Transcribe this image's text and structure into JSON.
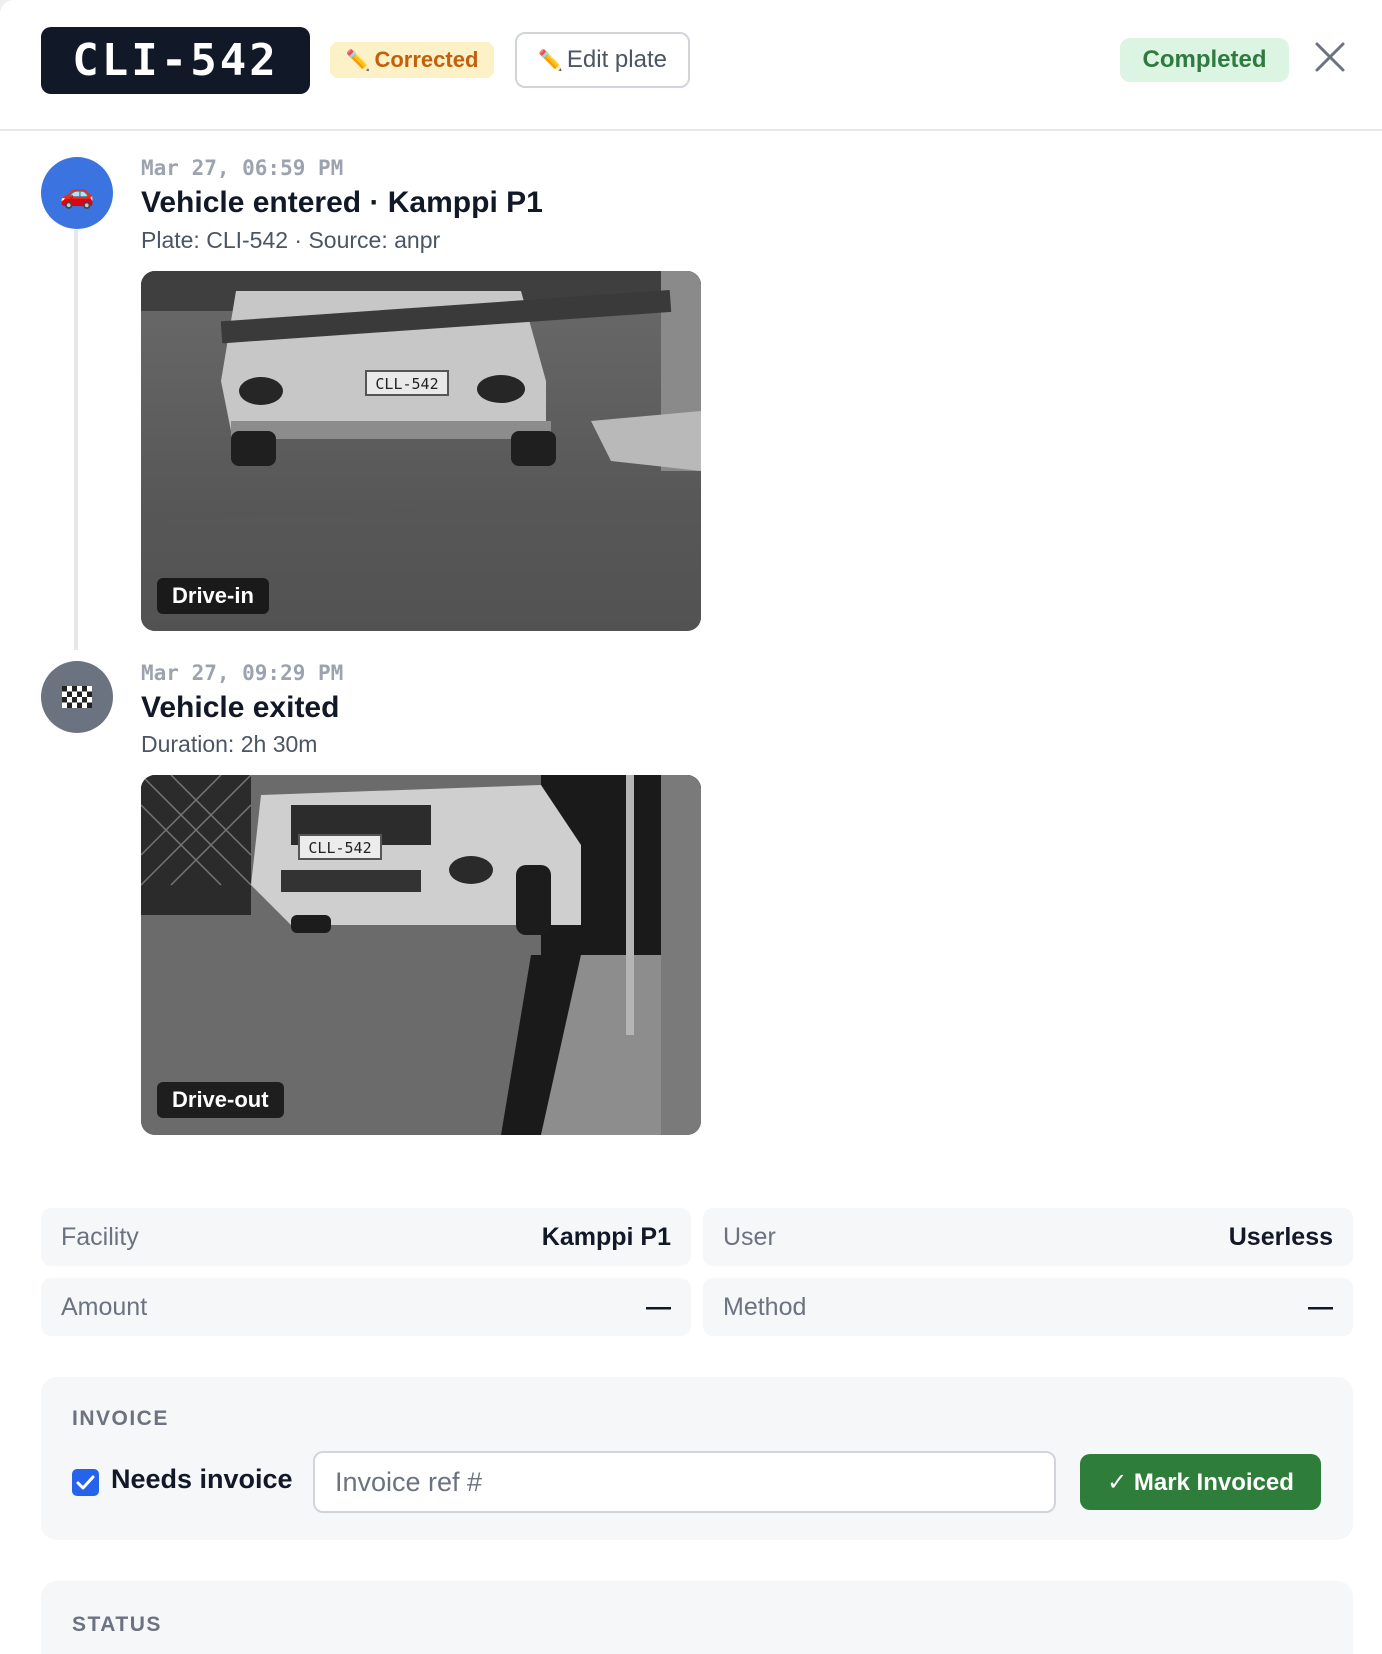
{
  "header": {
    "plate": "CLI-542",
    "corrected_badge": "Corrected",
    "edit_plate_label": "Edit plate",
    "status_badge": "Completed"
  },
  "timeline": [
    {
      "time": "Mar 27, 06:59 PM",
      "title": "Vehicle entered · Kamppi P1",
      "subtitle": "Plate: CLI-542 · Source: anpr",
      "photo_label": "Drive-in",
      "photo_plate_text": "CLL-542",
      "icon": "car-icon"
    },
    {
      "time": "Mar 27, 09:29 PM",
      "title": "Vehicle exited",
      "subtitle": "Duration: 2h 30m",
      "photo_label": "Drive-out",
      "photo_plate_text": "CLL-542",
      "icon": "checkered-flag-icon"
    }
  ],
  "details": {
    "facility_label": "Facility",
    "facility_value": "Kamppi P1",
    "user_label": "User",
    "user_value": "Userless",
    "amount_label": "Amount",
    "amount_value": "—",
    "method_label": "Method",
    "method_value": "—"
  },
  "invoice": {
    "title": "INVOICE",
    "needs_invoice_label": "Needs invoice",
    "needs_invoice_checked": true,
    "ref_placeholder": "Invoice ref #",
    "ref_value": "",
    "mark_button": "✓ Mark Invoiced"
  },
  "status_section": {
    "title": "STATUS"
  },
  "colors": {
    "plate_bg": "#111827",
    "corrected_bg": "#fdf1c7",
    "corrected_text": "#c2600c",
    "completed_bg": "#dcf5e2",
    "completed_text": "#2f7a3e",
    "enter_dot": "#3b73e0",
    "exit_dot": "#6b7280",
    "mark_button": "#2e7d3b",
    "checkbox": "#2563eb"
  }
}
